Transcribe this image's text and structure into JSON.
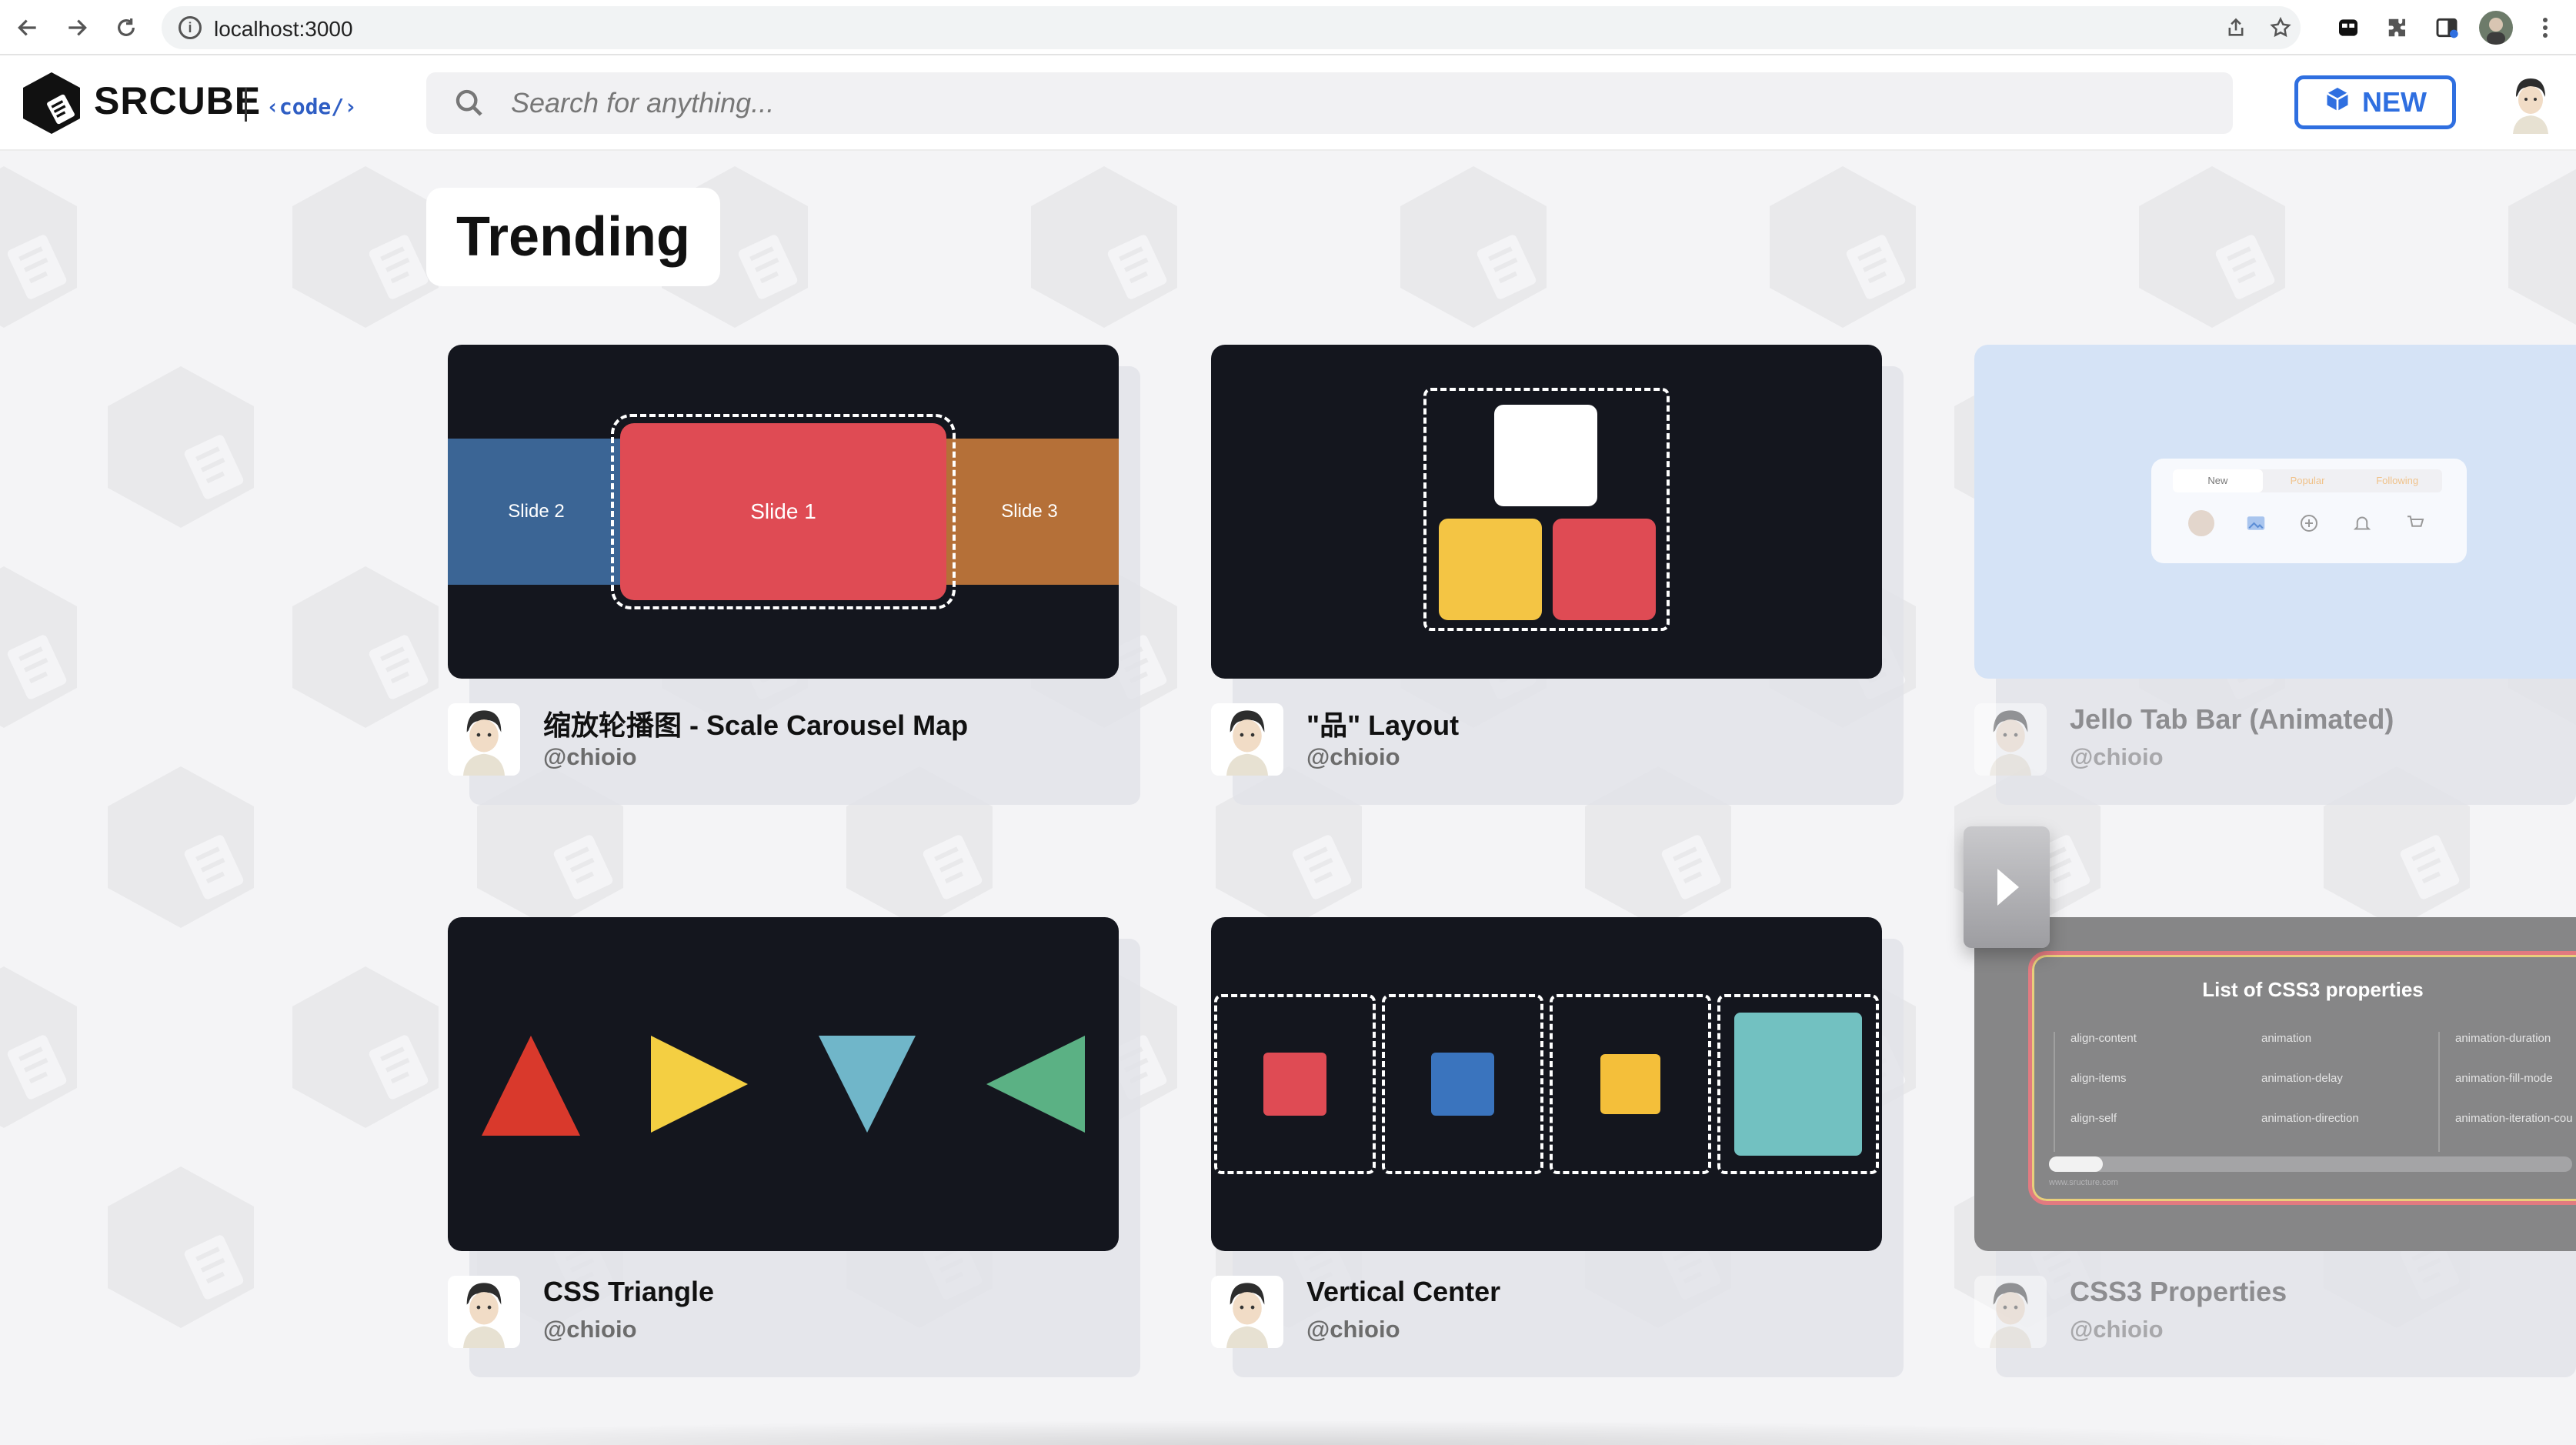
{
  "browser": {
    "url": "localhost:3000"
  },
  "header": {
    "logo_text": "SRCUBE",
    "logo_code": "‹code/›",
    "search_placeholder": "Search for anything...",
    "new_button_label": "NEW"
  },
  "trending": {
    "title": "Trending"
  },
  "cards": [
    {
      "title": "缩放轮播图 - Scale Carousel Map",
      "author": "@chioio",
      "thumb": {
        "slides": [
          "Slide 2",
          "Slide 1",
          "Slide 3"
        ]
      }
    },
    {
      "title": "\"品\" Layout",
      "author": "@chioio"
    },
    {
      "title": "Jello Tab Bar (Animated)",
      "author": "@chioio",
      "thumb": {
        "tabs": [
          "New",
          "Popular",
          "Following"
        ]
      }
    },
    {
      "title": "CSS Triangle",
      "author": "@chioio"
    },
    {
      "title": "Vertical Center",
      "author": "@chioio"
    },
    {
      "title": "CSS3 Properties",
      "author": "@chioio",
      "thumb": {
        "heading": "List of CSS3 properties",
        "properties": [
          [
            "align-content",
            "animation",
            "animation-duration"
          ],
          [
            "align-items",
            "animation-delay",
            "animation-fill-mode"
          ],
          [
            "align-self",
            "animation-direction",
            "animation-iteration-cou"
          ]
        ],
        "footer": "www.sructure.com"
      }
    }
  ],
  "colors": {
    "accent": "#2f6fe0",
    "thumb_bg": "#14161e",
    "red": "#df4b54",
    "yellow": "#f4c544",
    "blue_slide": "#3b6595",
    "orange_slide": "#b57038",
    "teal": "#72c1c1",
    "css_blue": "#3a74be"
  }
}
